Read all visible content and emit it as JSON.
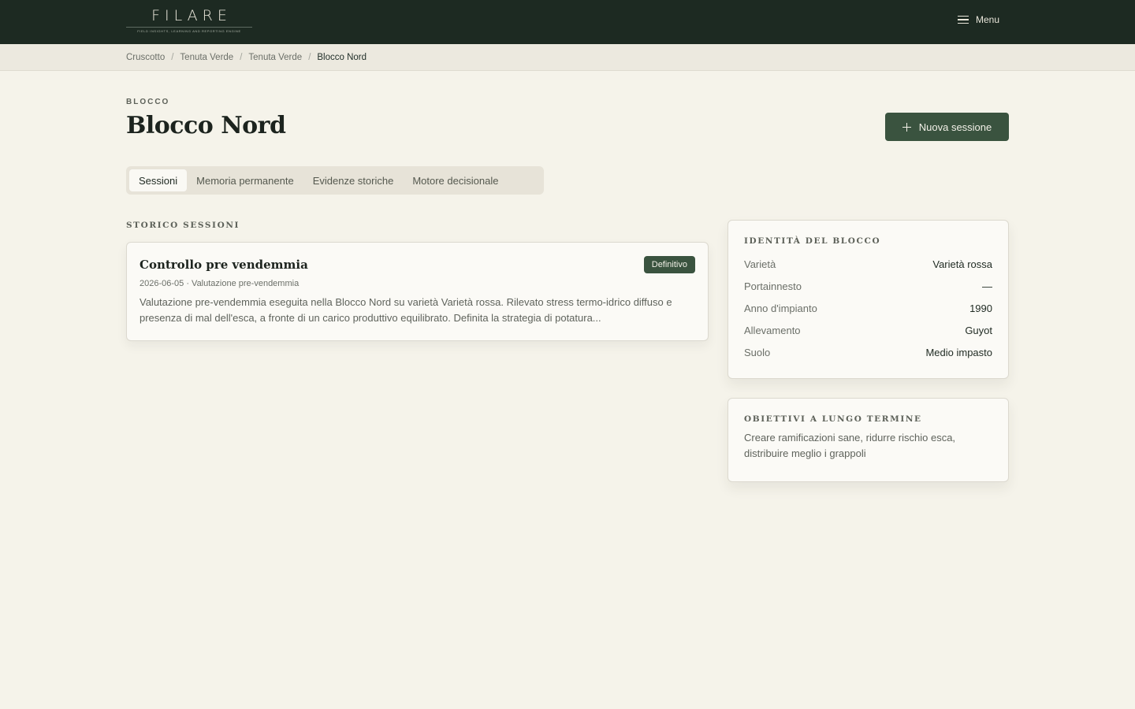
{
  "header": {
    "logo_word": "FILARE",
    "logo_tagline": "FIELD INSIGHTS, LEARNING AND REPORTING ENGINE",
    "menu_label": "Menu"
  },
  "breadcrumb": [
    "Cruscotto",
    "Tenuta Verde",
    "Tenuta Verde",
    "Blocco Nord"
  ],
  "page": {
    "eyebrow": "BLOCCO",
    "title": "Blocco Nord",
    "new_session_label": "Nuova sessione"
  },
  "tabs": [
    {
      "label": "Sessioni",
      "active": true
    },
    {
      "label": "Memoria permanente",
      "active": false
    },
    {
      "label": "Evidenze storiche",
      "active": false
    },
    {
      "label": "Motore decisionale",
      "active": false
    }
  ],
  "sessions": {
    "section_label": "STORICO SESSIONI",
    "items": [
      {
        "title": "Controllo pre vendemmia",
        "badge": "Definitivo",
        "meta": "2026-06-05 · Valutazione pre-vendemmia",
        "description": "Valutazione pre-vendemmia eseguita nella Blocco Nord su varietà Varietà rossa. Rilevato stress termo-idrico diffuso e presenza di mal dell'esca, a fronte di un carico produttivo equilibrato. Definita la strategia di potatura..."
      }
    ]
  },
  "identity": {
    "title": "IDENTITÀ DEL BLOCCO",
    "rows": [
      {
        "label": "Varietà",
        "value": "Varietà rossa"
      },
      {
        "label": "Portainnesto",
        "value": "—"
      },
      {
        "label": "Anno d'impianto",
        "value": "1990"
      },
      {
        "label": "Allevamento",
        "value": "Guyot"
      },
      {
        "label": "Suolo",
        "value": "Medio impasto"
      }
    ]
  },
  "objectives": {
    "title": "OBIETTIVI A LUNGO TERMINE",
    "text": "Creare ramificazioni sane, ridurre rischio esca, distribuire meglio i grappoli"
  },
  "colors": {
    "topbar": "#1d2a22",
    "accent": "#3a533f",
    "background": "#f5f3ea"
  }
}
